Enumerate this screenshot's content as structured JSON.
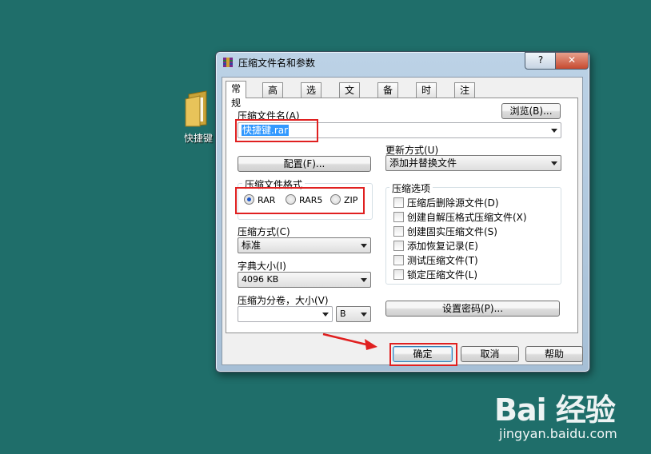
{
  "desktop": {
    "icon_label": "快捷键"
  },
  "window": {
    "title": "压缩文件名和参数",
    "help_label": "?",
    "close_label": "✕"
  },
  "tabs": [
    "常规",
    "高级",
    "选项",
    "文件",
    "备份",
    "时间",
    "注释"
  ],
  "general": {
    "archive_name_label": "压缩文件名(A)",
    "browse_label": "浏览(B)...",
    "archive_name_value": "快捷键.rar",
    "update_mode_label": "更新方式(U)",
    "update_mode_value": "添加并替换文件",
    "profiles_label": "配置(F)...",
    "format_group_label": "压缩文件格式",
    "formats": [
      {
        "label": "RAR",
        "selected": true
      },
      {
        "label": "RAR5",
        "selected": false
      },
      {
        "label": "ZIP",
        "selected": false
      }
    ],
    "method_label": "压缩方式(C)",
    "method_value": "标准",
    "dict_label": "字典大小(I)",
    "dict_value": "4096 KB",
    "split_label": "压缩为分卷，大小(V)",
    "split_value": "",
    "split_unit": "B",
    "options_group_label": "压缩选项",
    "options": [
      {
        "label": "压缩后删除源文件(D)",
        "checked": false
      },
      {
        "label": "创建自解压格式压缩文件(X)",
        "checked": false
      },
      {
        "label": "创建固实压缩文件(S)",
        "checked": false
      },
      {
        "label": "添加恢复记录(E)",
        "checked": false
      },
      {
        "label": "测试压缩文件(T)",
        "checked": false
      },
      {
        "label": "锁定压缩文件(L)",
        "checked": false
      }
    ],
    "password_label": "设置密码(P)..."
  },
  "buttons": {
    "ok": "确定",
    "cancel": "取消",
    "help": "帮助"
  },
  "watermark": {
    "logo_text": "Bai 经验",
    "site": "jingyan.baidu.com"
  },
  "colors": {
    "desktop": "#1f6e6a",
    "highlight": "#e02020",
    "selection": "#3399ff"
  }
}
